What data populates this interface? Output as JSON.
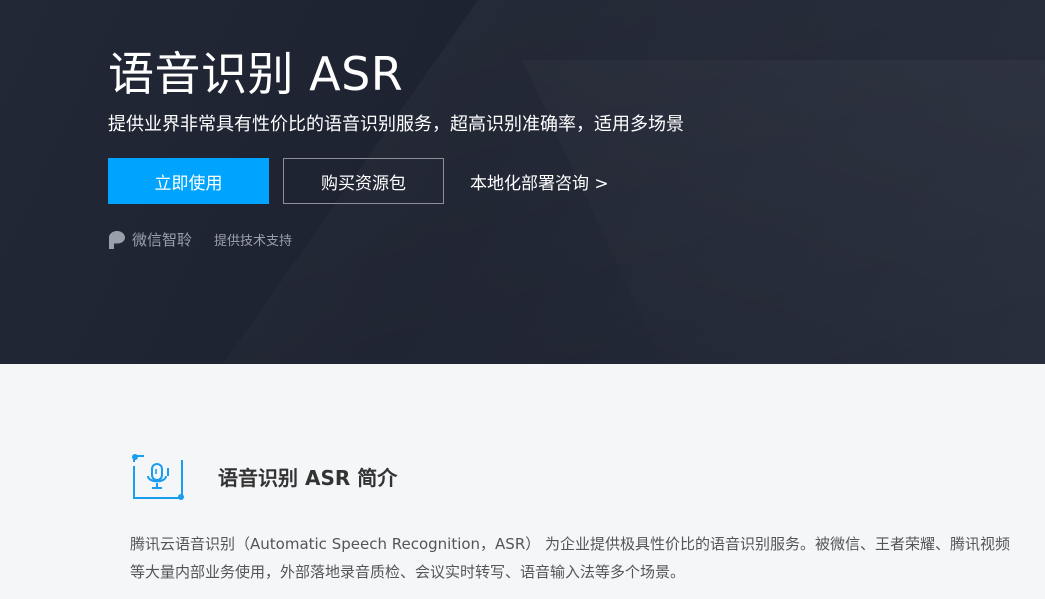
{
  "hero": {
    "title": "语音识别 ASR",
    "subtitle": "提供业界非常具有性价比的语音识别服务，超高识别准确率，适用多场景",
    "primary_button": "立即使用",
    "secondary_button": "购买资源包",
    "consult_link": "本地化部署咨询 >",
    "partner_name": "微信智聆",
    "partner_note": "提供技术支持"
  },
  "intro": {
    "icon": "microphone-icon",
    "title": "语音识别 ASR 简介",
    "text": "腾讯云语音识别（Automatic Speech Recognition，ASR） 为企业提供极具性价比的语音识别服务。被微信、王者荣耀、腾讯视频等大量内部业务使用，外部落地录音质检、会议实时转写、语音输入法等多个场景。"
  },
  "colors": {
    "accent": "#00a4ff",
    "hero_bg": "#1f2432"
  }
}
